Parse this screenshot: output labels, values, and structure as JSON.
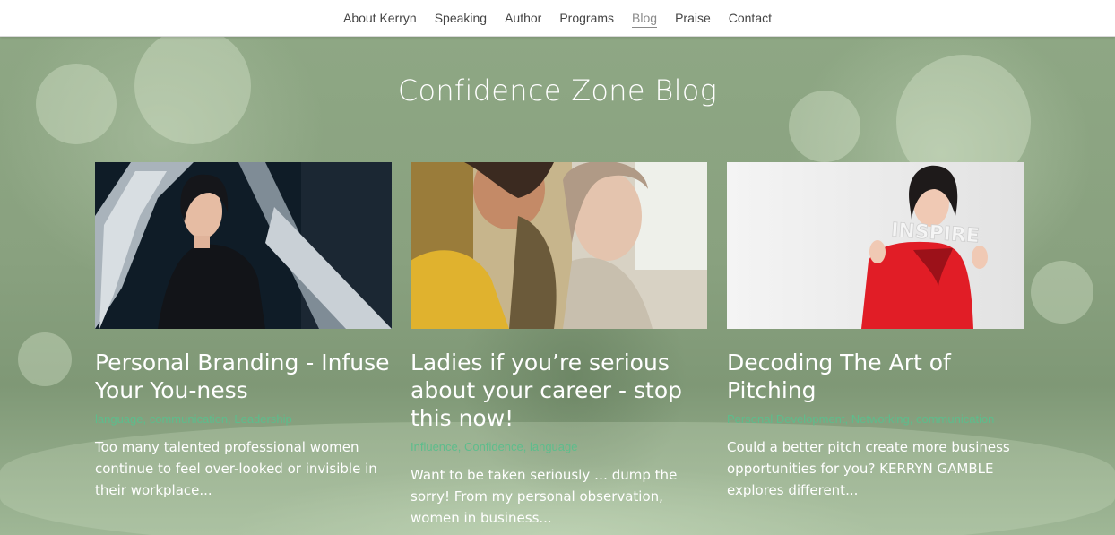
{
  "nav": {
    "items": [
      {
        "label": "About Kerryn",
        "active": false
      },
      {
        "label": "Speaking",
        "active": false
      },
      {
        "label": "Author",
        "active": false
      },
      {
        "label": "Programs",
        "active": false
      },
      {
        "label": "Blog",
        "active": true
      },
      {
        "label": "Praise",
        "active": false
      },
      {
        "label": "Contact",
        "active": false
      }
    ]
  },
  "hero": {
    "title": "Confidence Zone Blog"
  },
  "posts": [
    {
      "title": "Personal Branding - Infuse Your You-ness",
      "tags": "language, communication, Leadership",
      "excerpt": "Too many talented professional women continue to feel over-looked or invisible in their workplace..."
    },
    {
      "title": "Ladies if you’re serious about your career - stop this now!",
      "tags": "Influence, Confidence, language",
      "excerpt": "Want to be taken seriously … dump the sorry! From my personal observation, women in business..."
    },
    {
      "title": "Decoding The Art of Pitching",
      "tags": "Personal Development, Networking, communication",
      "excerpt": "Could a better pitch create more business opportunities for you? KERRYN GAMBLE explores different..."
    }
  ],
  "colors": {
    "tag_link": "#5dbd8c",
    "hero_bg": "#8aa681",
    "nav_text": "#444444"
  }
}
